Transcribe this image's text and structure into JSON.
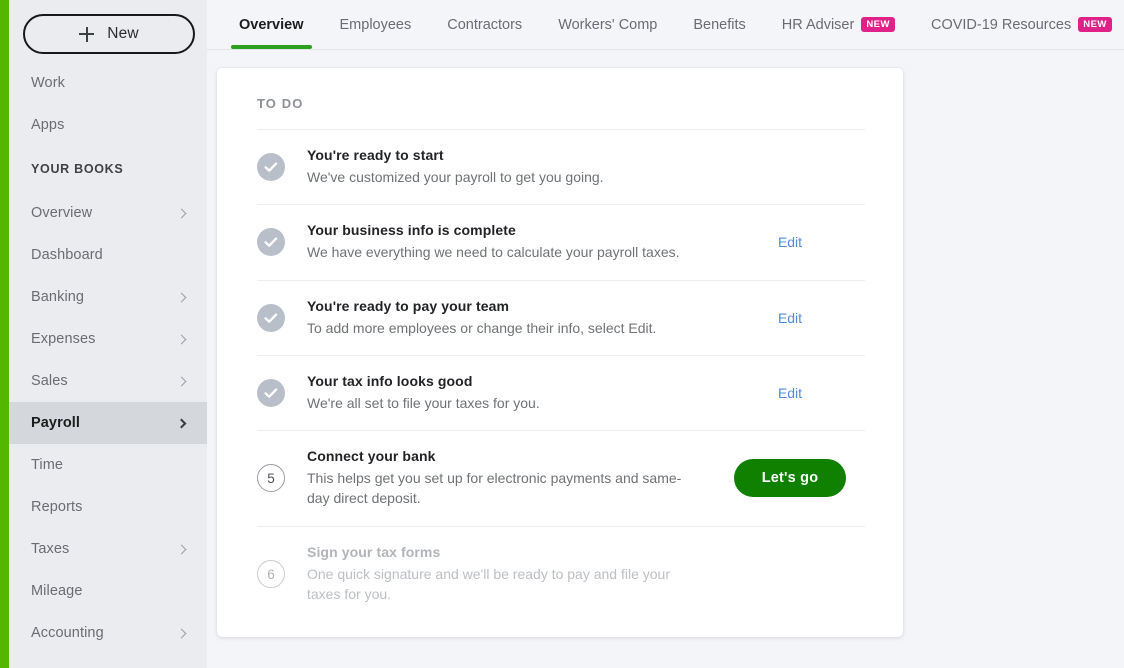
{
  "sidebar": {
    "new_button": {
      "label": "New",
      "icon": "plus-icon"
    },
    "top_items": [
      {
        "label": "Work",
        "chevron": false
      },
      {
        "label": "Apps",
        "chevron": false
      }
    ],
    "section_header": "YOUR BOOKS",
    "items": [
      {
        "label": "Overview",
        "chevron": true,
        "active": false
      },
      {
        "label": "Dashboard",
        "chevron": false,
        "active": false
      },
      {
        "label": "Banking",
        "chevron": true,
        "active": false
      },
      {
        "label": "Expenses",
        "chevron": true,
        "active": false
      },
      {
        "label": "Sales",
        "chevron": true,
        "active": false
      },
      {
        "label": "Payroll",
        "chevron": true,
        "active": true
      },
      {
        "label": "Time",
        "chevron": false,
        "active": false
      },
      {
        "label": "Reports",
        "chevron": false,
        "active": false
      },
      {
        "label": "Taxes",
        "chevron": true,
        "active": false
      },
      {
        "label": "Mileage",
        "chevron": false,
        "active": false
      },
      {
        "label": "Accounting",
        "chevron": true,
        "active": false
      }
    ]
  },
  "tabs": [
    {
      "label": "Overview",
      "active": true,
      "badge": null
    },
    {
      "label": "Employees",
      "active": false,
      "badge": null
    },
    {
      "label": "Contractors",
      "active": false,
      "badge": null
    },
    {
      "label": "Workers' Comp",
      "active": false,
      "badge": null
    },
    {
      "label": "Benefits",
      "active": false,
      "badge": null
    },
    {
      "label": "HR Adviser",
      "active": false,
      "badge": "NEW"
    },
    {
      "label": "COVID-19 Resources",
      "active": false,
      "badge": "NEW"
    }
  ],
  "todo": {
    "title": "TO DO",
    "items": [
      {
        "marker": "check",
        "number": null,
        "heading": "You're ready to start",
        "sub": "We've customized your payroll to get you going.",
        "action": null,
        "action_label": null,
        "muted": false
      },
      {
        "marker": "check",
        "number": null,
        "heading": "Your business info is complete",
        "sub": "We have everything we need to calculate your payroll taxes.",
        "action": "link",
        "action_label": "Edit",
        "muted": false
      },
      {
        "marker": "check",
        "number": null,
        "heading": "You're ready to pay your team",
        "sub": "To add more employees or change their info, select Edit.",
        "action": "link",
        "action_label": "Edit",
        "muted": false
      },
      {
        "marker": "check",
        "number": null,
        "heading": "Your tax info looks good",
        "sub": "We're all set to file your taxes for you.",
        "action": "link",
        "action_label": "Edit",
        "muted": false
      },
      {
        "marker": "number",
        "number": "5",
        "heading": "Connect your bank",
        "sub": "This helps get you set up for electronic payments and same-day direct deposit.",
        "action": "button",
        "action_label": "Let's go",
        "muted": false
      },
      {
        "marker": "number",
        "number": "6",
        "heading": "Sign your tax forms",
        "sub": "One quick signature and we'll be ready to pay and file your taxes for you.",
        "action": null,
        "action_label": null,
        "muted": true
      }
    ]
  },
  "colors": {
    "accent_strip": "#53B700",
    "tab_underline": "#2CA01C",
    "cta_green": "#108000",
    "badge_pink": "#E0218A",
    "link_blue": "#4F8CE0",
    "sidebar_bg": "#EAECEF",
    "active_nav_bg": "#D4D7DC",
    "page_bg": "#F4F5F8",
    "check_circle": "#B8BFC9"
  }
}
